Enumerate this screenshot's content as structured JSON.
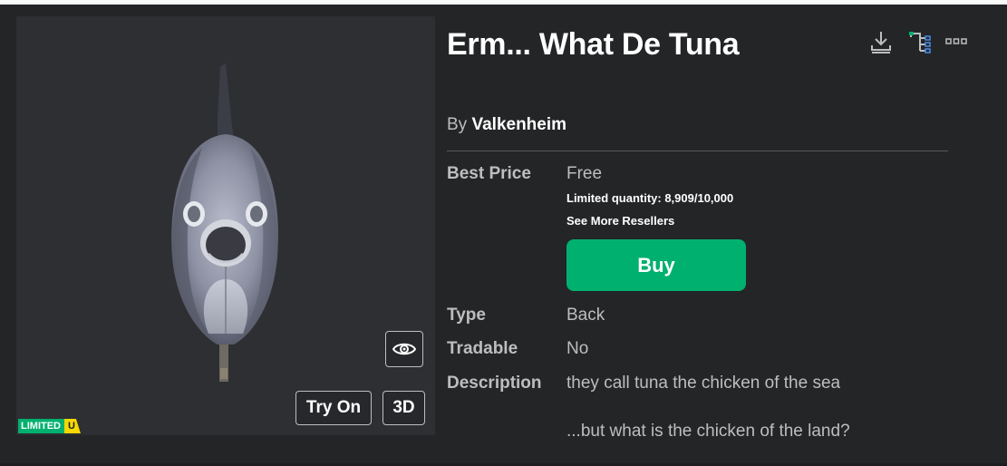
{
  "item": {
    "title": "Erm... What De Tuna",
    "by_label": "By",
    "creator": "Valkenheim",
    "is_limited": true
  },
  "thumbnail": {
    "badge_limited": "LIMITED",
    "badge_unique": "U",
    "try_on_label": "Try On",
    "three_d_label": "3D"
  },
  "header_icons": [
    "download-icon",
    "hierarchy-icon",
    "more-icon"
  ],
  "price": {
    "label": "Best Price",
    "value": "Free",
    "quantity_text": "Limited quantity: 8,909/10,000",
    "resellers_link": "See More Resellers"
  },
  "buy_button_label": "Buy",
  "details": {
    "type_label": "Type",
    "type_value": "Back",
    "tradable_label": "Tradable",
    "tradable_value": "No",
    "description_label": "Description",
    "description_line1": "they call tuna the chicken of the sea",
    "description_line2": "...but what is the chicken of the land?"
  },
  "colors": {
    "background": "#232527",
    "panel": "#2d2f32",
    "accent_green": "#00b06f",
    "unique_yellow": "#f5d800",
    "muted_text": "#bdbebe"
  }
}
